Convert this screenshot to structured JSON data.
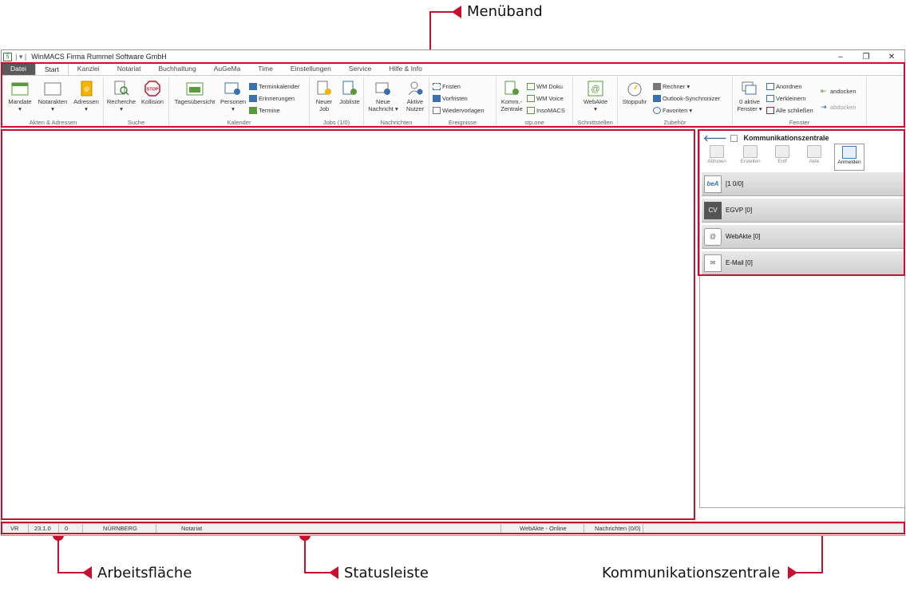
{
  "callouts": {
    "menueband": "Menüband",
    "arbeitsflaeche": "Arbeitsfläche",
    "statusleiste": "Statusleiste",
    "kommunikationszentrale": "Kommunikationszentrale"
  },
  "window": {
    "title": "WinMACS Firma Rummel Software GmbH",
    "controls": {
      "minimize": "–",
      "restore": "❐",
      "close": "✕"
    }
  },
  "tabs": [
    "Datei",
    "Start",
    "Kanzlei",
    "Notariat",
    "Buchhaltung",
    "AuGeMa",
    "Time",
    "Einstellungen",
    "Service",
    "Hilfe & Info"
  ],
  "ribbon": {
    "akten": {
      "label": "Akten & Adressen",
      "mandate": "Mandate",
      "notarakten": "Notarakten",
      "adressen": "Adressen"
    },
    "suche": {
      "label": "Suche",
      "recherche": "Recherche",
      "kollision": "Kollision",
      "stop": "STOP"
    },
    "kalender": {
      "label": "Kalender",
      "tagesuebersicht": "Tagesübersicht",
      "personen": "Personen",
      "terminkalender": "Terminkalender",
      "erinnerungen": "Erinnerungen",
      "termine": "Termine"
    },
    "jobs": {
      "label": "Jobs (1/0)",
      "neuer_job": "Neuer Job",
      "jobliste": "Jobliste"
    },
    "nachrichten": {
      "label": "Nachrichten",
      "neue_nachricht": "Neue Nachricht",
      "aktive_nutzer": "Aktive Nutzer"
    },
    "ereignisse": {
      "label": "Ereignisse",
      "fristen": "Fristen",
      "vorfristen": "Vorfristen",
      "wiedervorlagen": "Wiedervorlagen"
    },
    "stpone": {
      "label": "stp.one",
      "komm_zentrale": "Komm.-Zentrale",
      "wm_doku": "WM Doku",
      "wm_voice": "WM Voice",
      "insomacs": "InsoMACS"
    },
    "schnittstellen": {
      "label": "Schnittstellen",
      "webakte": "WebAkte"
    },
    "zubehoer": {
      "label": "Zubehör",
      "stoppuhr": "Stoppuhr",
      "rechner": "Rechner",
      "outlook": "Outlook-Synchronizer",
      "favoriten": "Favoriten"
    },
    "fenster": {
      "label": "Fenster",
      "aktive_fenster": "0 aktive Fenster",
      "anordnen": "Anordnen",
      "verkleinern": "Verkleinern",
      "alle_schliessen": "Alle schließen",
      "andocken": "andocken",
      "abdocken": "abdocken"
    }
  },
  "kommunikation": {
    "title": "Kommunikationszentrale",
    "toolbar": [
      "Abholen",
      "Erstellen",
      "Entf",
      "Akte",
      "Anmelden"
    ],
    "rows": [
      {
        "icon": "beA",
        "label": "[1 0/0]"
      },
      {
        "icon": "CV",
        "label": "EGVP [0]"
      },
      {
        "icon": "@",
        "label": "WebAkte [0]"
      },
      {
        "icon": "✉",
        "label": "E-Mail [0]"
      }
    ]
  },
  "statusbar": {
    "vr": "VR",
    "version": "23.1.0",
    "count": "0",
    "ort": "NÜRNBERG",
    "bereich": "Notariat",
    "webakte": "WebAkte - Online",
    "nachrichten": "Nachrichten (0/0)"
  },
  "colors": {
    "accent": "#c8102e",
    "ribbon_bg": "#fbfbfb",
    "file_tab": "#5a5a5a"
  }
}
